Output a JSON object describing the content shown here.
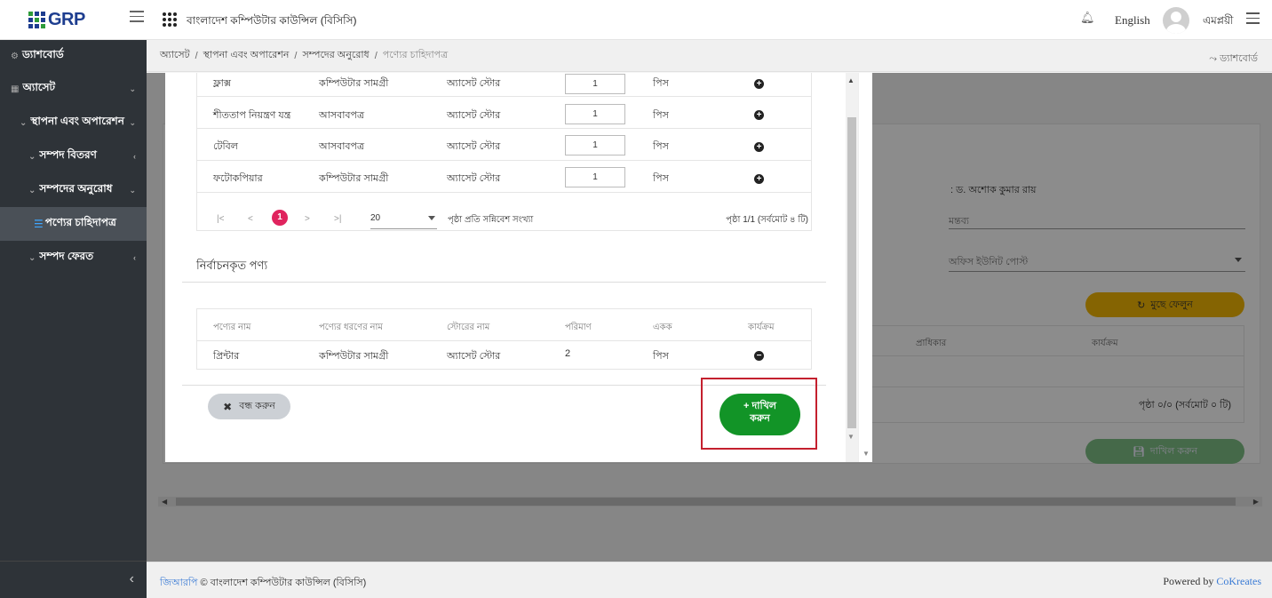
{
  "header": {
    "logo_text": "GRP",
    "org_title": "বাংলাদেশ কম্পিউটার কাউন্সিল (বিসিসি)",
    "language": "English",
    "user_name": "এমপ্লয়ী"
  },
  "sidebar": {
    "dashboard": "ড্যাশবোর্ড",
    "asset": "অ্যাসেট",
    "install_ops": "স্থাপনা এবং অপারেশন",
    "distribution": "সম্পদ বিতরণ",
    "request": "সম্পদের অনুরোধ",
    "requisition": "পণ্যের চাহিদাপত্র",
    "return": "সম্পদ ফেরত"
  },
  "breadcrumb": {
    "items": [
      "অ্যাসেট",
      "স্থাপনা এবং অপারেশন",
      "সম্পদের অনুরোধ"
    ],
    "current": "পণ্যের চাহিদাপত্র",
    "dashboard_link": "ড্যাশবোর্ড"
  },
  "background": {
    "doctor": ": ড. অশোক কুমার রায়",
    "comment_placeholder": "মন্তব্য",
    "post_placeholder": "অফিস ইউনিট পোস্ট",
    "reset_label": "মুছে ফেলুন",
    "table_headers": [
      "প্রাধিকার",
      "কার্যক্রম"
    ],
    "page_info": "পৃষ্ঠা ০/০ (সর্বমোট ০ টি)",
    "submit_label": "দাখিল করুন"
  },
  "modal": {
    "available_rows": [
      {
        "name": "ফ্লাক্স",
        "type": "কম্পিউটার সামগ্রী",
        "store": "অ্যাসেট স্টোর",
        "qty": "1",
        "unit": "পিস"
      },
      {
        "name": "শীততাপ নিয়ন্ত্রণ যন্ত্র",
        "type": "আসবাবপত্র",
        "store": "অ্যাসেট স্টোর",
        "qty": "1",
        "unit": "পিস"
      },
      {
        "name": "টেবিল",
        "type": "আসবাবপত্র",
        "store": "অ্যাসেট স্টোর",
        "qty": "1",
        "unit": "পিস"
      },
      {
        "name": "ফটোকপিয়ার",
        "type": "কম্পিউটার সামগ্রী",
        "store": "অ্যাসেট স্টোর",
        "qty": "1",
        "unit": "পিস"
      }
    ],
    "pager": {
      "current_page": "1",
      "page_size": "20",
      "page_size_label": "পৃষ্ঠা প্রতি সন্নিবেশ সংখ্যা",
      "page_info": "পৃষ্ঠা 1/1 (সর্বমোট ৪ টি)"
    },
    "selected_title": "নির্বাচনকৃত পণ্য",
    "selected_headers": [
      "পণ্যের নাম",
      "পণ্যের ধরণের নাম",
      "স্টোরের নাম",
      "পরিমাণ",
      "একক",
      "কার্যক্রম"
    ],
    "selected_rows": [
      {
        "name": "প্রিন্টার",
        "type": "কম্পিউটার সামগ্রী",
        "store": "অ্যাসেট স্টোর",
        "qty": "2",
        "unit": "পিস"
      }
    ],
    "close_label": "বন্ধ করুন",
    "submit_line1": "দাখিল",
    "submit_line2": "করুন"
  },
  "footer": {
    "brand": "জিআরপি",
    "copyright": " © বাংলাদেশ কম্পিউটার কাউন্সিল (বিসিসি)",
    "powered_prefix": "Powered by ",
    "powered_brand": "CoKreates"
  },
  "colors": {
    "submit_green": "#129427",
    "highlight_red": "#c4202e",
    "reset_yellow": "#f2b705",
    "pager_active": "#e0245e"
  }
}
